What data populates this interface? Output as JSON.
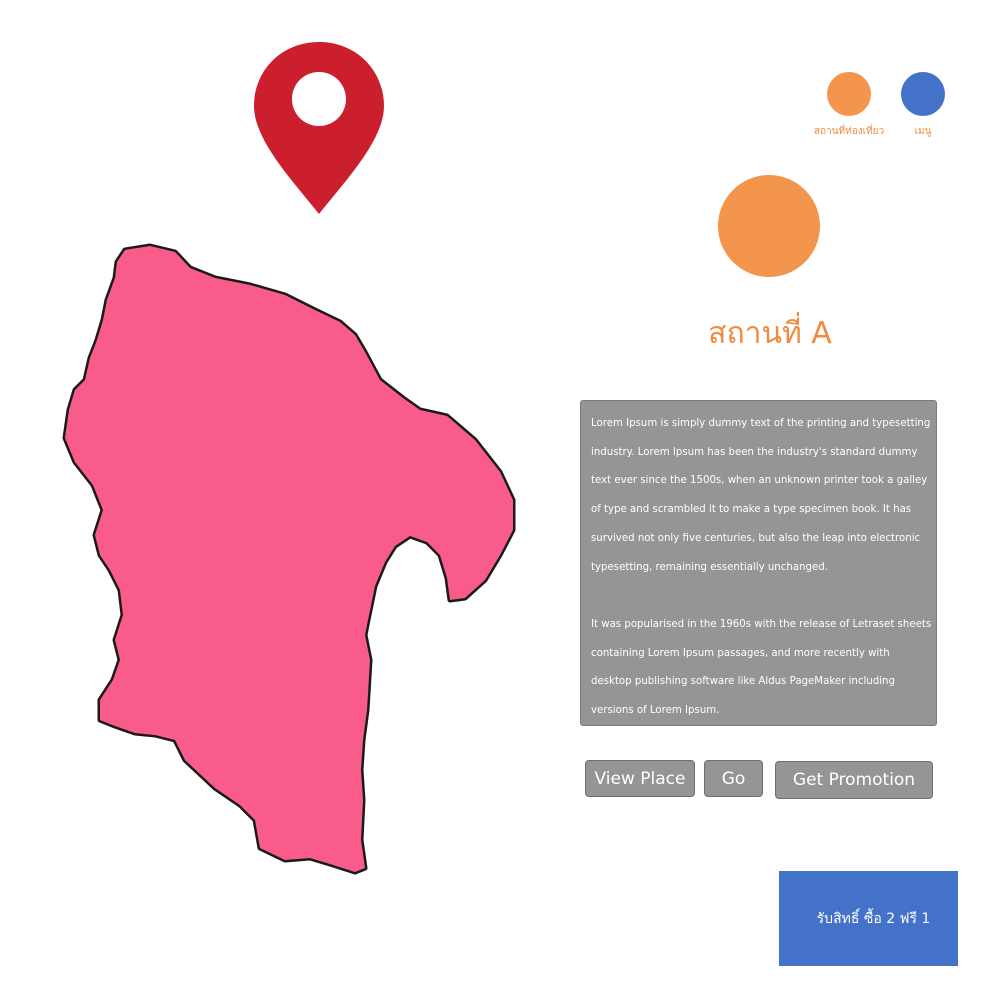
{
  "colors": {
    "pin": "#cc1f2e",
    "map_fill": "#f95c8a",
    "map_outline": "#1a1a1a",
    "accent_orange": "#f4954d",
    "accent_blue": "#4472c8",
    "panel_gray": "#959595"
  },
  "icons": {
    "pin": "map-pin-icon",
    "map": "region-map"
  },
  "nav": {
    "attractions_label": "สถานที่ท่องเที่ยว",
    "menu_label": "เมนู"
  },
  "place": {
    "title": "สถานที่ A",
    "description_p1": "Lorem Ipsum is simply dummy text of the printing and typesetting industry. Lorem Ipsum has been the industry's standard dummy text ever since the 1500s, when an unknown printer took a galley of type and scrambled it to make a type specimen book. It has survived not only five centuries, but also the leap into electronic typesetting, remaining essentially unchanged.",
    "description_p2": "It was popularised in the 1960s with the release of Letraset sheets containing Lorem Ipsum passages, and more recently with desktop publishing software like Aldus PageMaker including versions of Lorem Ipsum."
  },
  "actions": {
    "view_place": "View Place",
    "go": "Go",
    "get_promotion": "Get Promotion"
  },
  "promotion": {
    "banner_text": "รับสิทธิ์ ซื้อ 2 ฟรี 1"
  }
}
